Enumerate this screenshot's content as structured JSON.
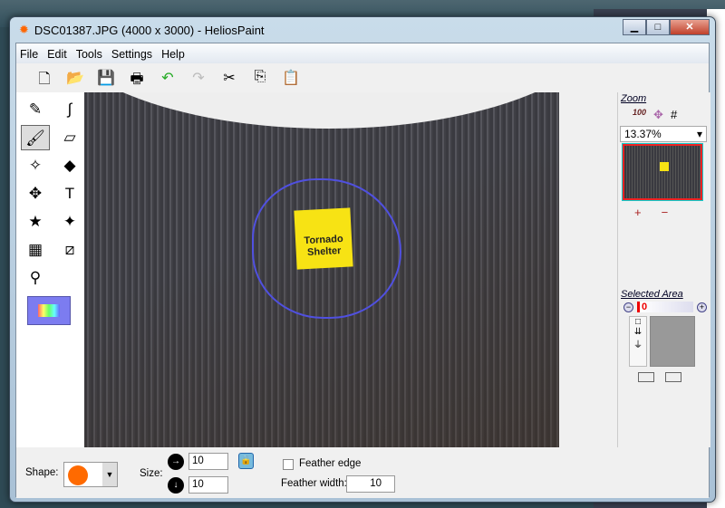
{
  "window": {
    "title": "DSC01387.JPG (4000 x 3000) - HeliosPaint",
    "minimize": "▁",
    "maximize": "□",
    "close": "✕"
  },
  "menu": [
    "File",
    "Edit",
    "Tools",
    "Settings",
    "Help"
  ],
  "toolbar": [
    {
      "icon": "new-icon",
      "glyph": "🗋"
    },
    {
      "icon": "open-icon",
      "glyph": "📂"
    },
    {
      "icon": "save-icon",
      "glyph": "💾"
    },
    {
      "icon": "print-icon",
      "glyph": "🖶"
    },
    {
      "icon": "undo-icon",
      "glyph": "↶"
    },
    {
      "icon": "redo-icon",
      "glyph": "↷"
    },
    {
      "icon": "cut-icon",
      "glyph": "✂"
    },
    {
      "icon": "copy-icon",
      "glyph": "⎘"
    },
    {
      "icon": "paste-icon",
      "glyph": "📋"
    }
  ],
  "tools": [
    {
      "icon": "pencil-icon",
      "glyph": "✎"
    },
    {
      "icon": "curve-icon",
      "glyph": "∫"
    },
    {
      "icon": "brush-icon",
      "glyph": "🖌",
      "selected": true
    },
    {
      "icon": "eraser-icon",
      "glyph": "▱"
    },
    {
      "icon": "spray-icon",
      "glyph": "✧"
    },
    {
      "icon": "fill-icon",
      "glyph": "◆"
    },
    {
      "icon": "move-icon",
      "glyph": "✥"
    },
    {
      "icon": "text-icon",
      "glyph": "T"
    },
    {
      "icon": "shapes-icon",
      "glyph": "★"
    },
    {
      "icon": "effects-icon",
      "glyph": "✦"
    },
    {
      "icon": "gradient-icon",
      "glyph": "▦"
    },
    {
      "icon": "transform-icon",
      "glyph": "⧄"
    },
    {
      "icon": "color-picker-icon",
      "glyph": "⚲"
    }
  ],
  "image": {
    "sign_text": "Tornado Shelter"
  },
  "zoom": {
    "label": "Zoom",
    "value": "13.37%",
    "actual_size": "100",
    "zoom_in": "+",
    "zoom_out": "−"
  },
  "selected_area": {
    "label": "Selected Area",
    "value": "0",
    "minus": "−",
    "plus": "+"
  },
  "bottom": {
    "shape_label": "Shape:",
    "shape_color": "#ff6a00",
    "size_label": "Size:",
    "width": "10",
    "height": "10",
    "feather_edge_label": "Feather edge",
    "feather_edge_checked": false,
    "feather_width_label": "Feather width:",
    "feather_width": "10"
  }
}
